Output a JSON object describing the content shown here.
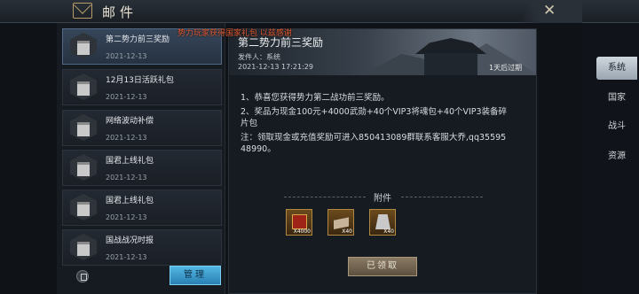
{
  "header": {
    "title": "邮件"
  },
  "notice": "势力玩家获得国家礼包 以兹感谢",
  "mail_list": [
    {
      "name": "第二势力前三奖励",
      "date": "2021-12-13"
    },
    {
      "name": "12月13日活跃礼包",
      "date": "2021-12-13"
    },
    {
      "name": "网络波动补偿",
      "date": "2021-12-13"
    },
    {
      "name": "国君上线礼包",
      "date": "2021-12-13"
    },
    {
      "name": "国君上线礼包",
      "date": "2021-12-13"
    },
    {
      "name": "国战战况时报",
      "date": "2021-12-13"
    }
  ],
  "footer": {
    "manage_label": "管理"
  },
  "detail": {
    "title": "第二势力前三奖励",
    "sender": "发件人：系统",
    "datetime": "2021-12-13 17:21:29",
    "expire": "1天后过期",
    "body_lines": [
      "1、恭喜您获得势力第二战功前三奖励。",
      "2、奖品为现金100元+4000武勋+40个VIP3将魂包+40个VIP3装备碎",
      "片包",
      "注：领取现金或充值奖励可进入850413089群联系客服大乔,qq35595",
      "48990。"
    ],
    "attachments_label": "附件",
    "rewards": [
      {
        "icon": "red-chest-icon",
        "count": "X4000"
      },
      {
        "icon": "scroll-pack-icon",
        "count": "X40"
      },
      {
        "icon": "armor-pack-icon",
        "count": "X40"
      }
    ],
    "claim_label": "已领取"
  },
  "tabs": [
    {
      "label": "系统",
      "active": true
    },
    {
      "label": "国家",
      "active": false
    },
    {
      "label": "战斗",
      "active": false
    },
    {
      "label": "资源",
      "active": false
    }
  ],
  "colors": {
    "accent_blue": "#3b9fd4",
    "notice_red": "#e25a32",
    "gold_frame": "#b08840"
  }
}
